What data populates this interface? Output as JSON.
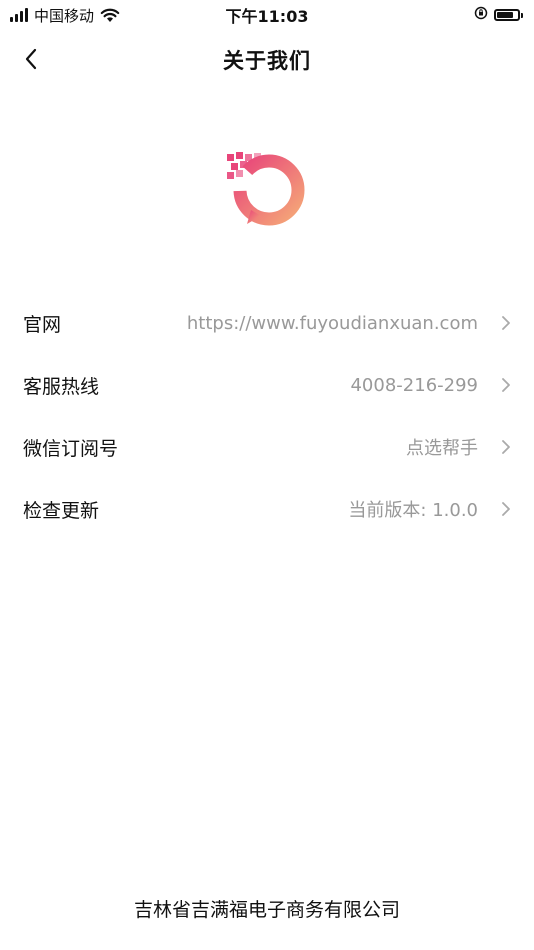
{
  "status_bar": {
    "carrier": "中国移动",
    "time": "下午11:03",
    "battery_level": 0.8
  },
  "nav": {
    "title": "关于我们",
    "back_icon": "chevron-left-icon"
  },
  "logo": {
    "icon": "app-logo-icon",
    "gradient_start": "#e8457a",
    "gradient_end": "#f5a878"
  },
  "rows": [
    {
      "label": "官网",
      "value": "https://www.fuyoudianxuan.com"
    },
    {
      "label": "客服热线",
      "value": "4008-216-299"
    },
    {
      "label": "微信订阅号",
      "value": "点选帮手"
    },
    {
      "label": "检查更新",
      "value": "当前版本: 1.0.0"
    }
  ],
  "footer": {
    "company": "吉林省吉满福电子商务有限公司"
  },
  "colors": {
    "text_primary": "#111111",
    "text_secondary": "#999999",
    "chevron": "#aaaaaa",
    "background": "#ffffff"
  }
}
